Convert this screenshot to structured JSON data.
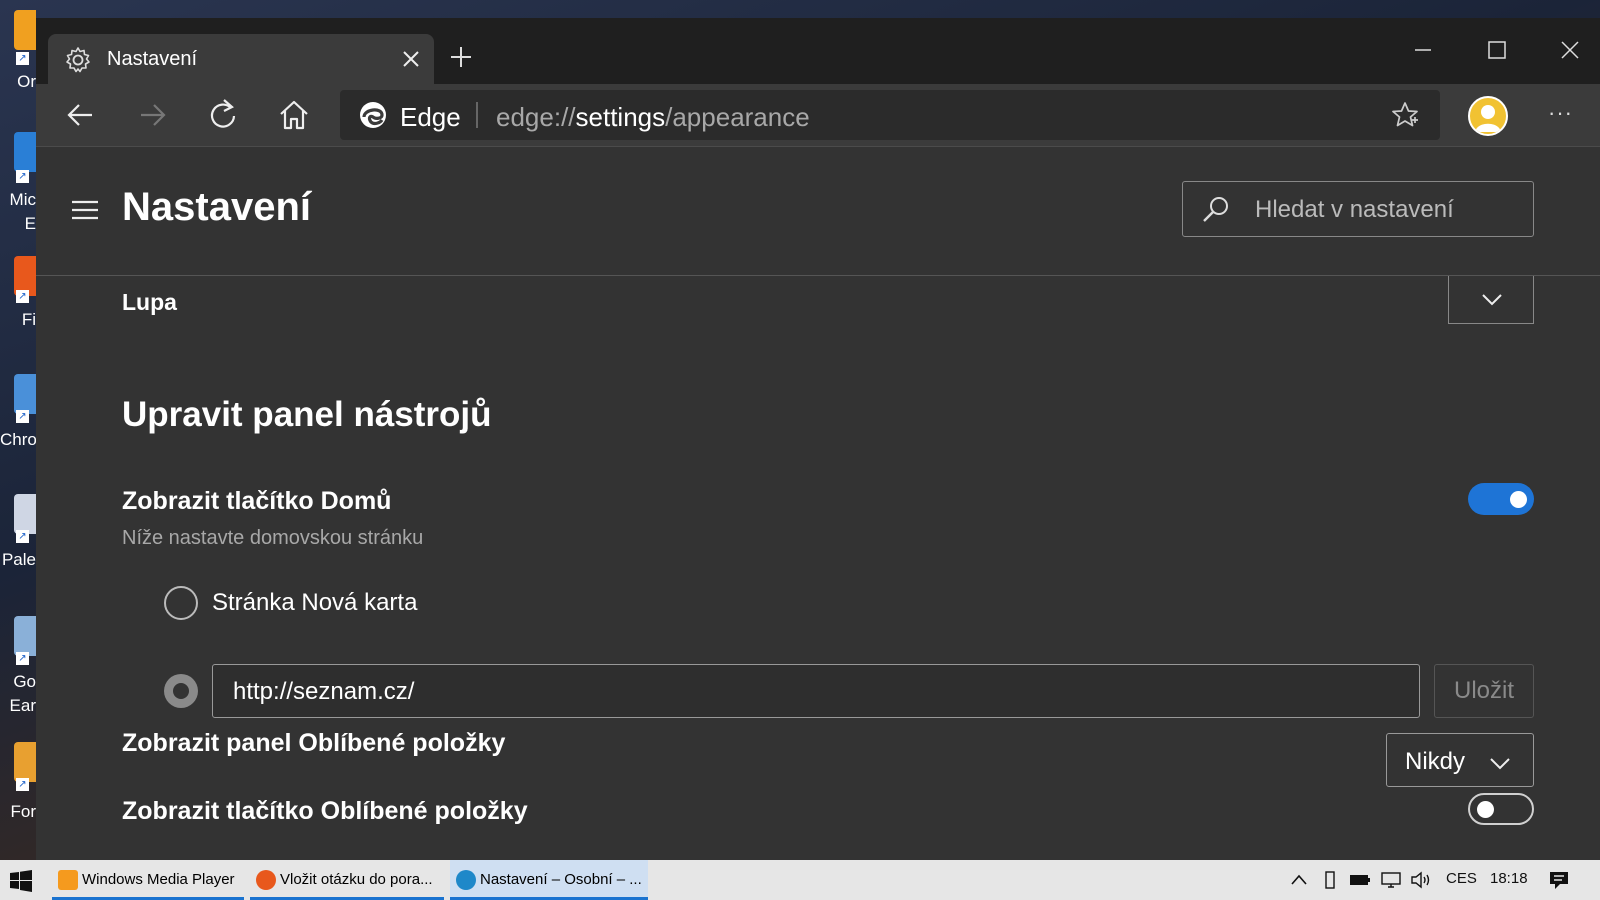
{
  "desktop": {
    "icons": [
      {
        "label": "Or",
        "color": "#f0a020"
      },
      {
        "label": "Mic",
        "label2": "E",
        "color": "#2a7fd6"
      },
      {
        "label": "Fi",
        "color": "#e8581c"
      },
      {
        "label": "Chro",
        "color": "#4a90d9"
      },
      {
        "label": "Pale",
        "color": "#cfd6e4"
      },
      {
        "label": "Go",
        "label2": "Ear",
        "color": "#8ab0d8"
      },
      {
        "label": "For",
        "color": "#e8a030"
      }
    ]
  },
  "browser": {
    "tab": {
      "title": "Nastavení"
    },
    "address": {
      "brand": "Edge",
      "url_prefix": "edge://",
      "url_host": "settings",
      "url_path": "/appearance"
    },
    "more": "···"
  },
  "settings": {
    "page_title": "Nastavení",
    "search_placeholder": "Hledat v nastavení",
    "zoom_label": "Lupa",
    "section_title": "Upravit panel nástrojů",
    "home_button": {
      "label": "Zobrazit tlačítko Domů",
      "subtitle": "Níže nastavte domovskou stránku",
      "enabled": true,
      "option_newtab": "Stránka Nová karta",
      "url_value": "http://seznam.cz/",
      "save_label": "Uložit",
      "selected_option": "url"
    },
    "favorites_bar": {
      "label": "Zobrazit panel Oblíbené položky",
      "value": "Nikdy"
    },
    "favorites_button": {
      "label": "Zobrazit tlačítko Oblíbené položky",
      "enabled": false
    }
  },
  "taskbar": {
    "items": [
      {
        "label": "Windows Media Player",
        "color": "#f59a1e"
      },
      {
        "label": "Vložit otázku do pora...",
        "color": "#e8581c"
      },
      {
        "label": "Nastavení – Osobní – ...",
        "color": "#1e88c9"
      }
    ],
    "language": "CES",
    "time": "18:18"
  },
  "colors": {
    "accent": "#1e74d6",
    "background": "#333333"
  }
}
